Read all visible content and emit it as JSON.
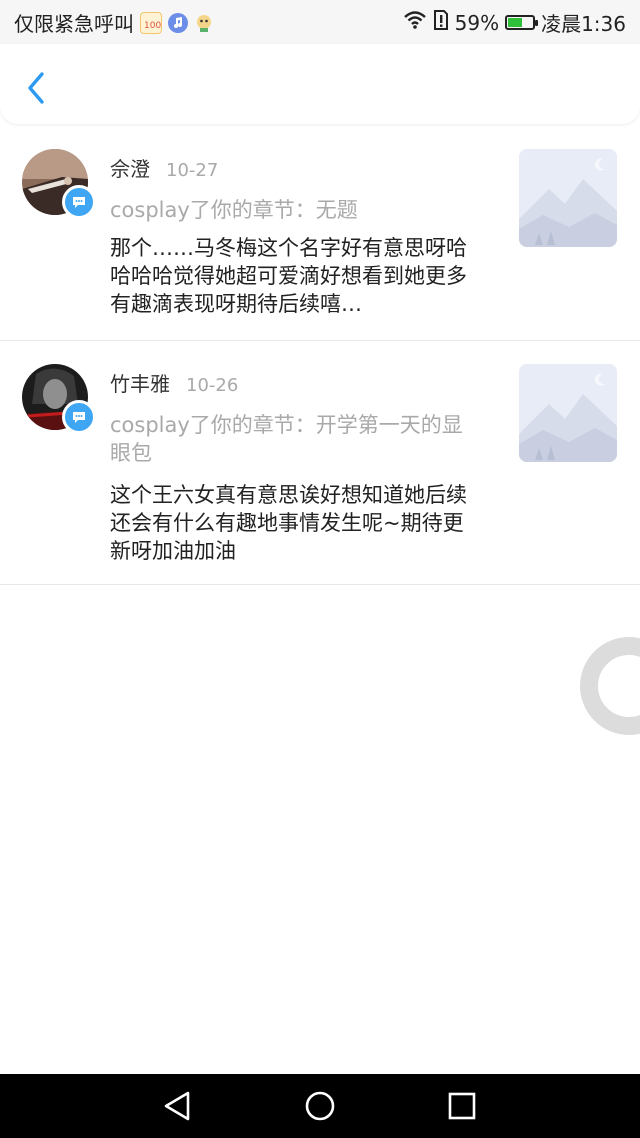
{
  "status_bar": {
    "carrier": "仅限紧急呼叫",
    "battery_percent": "59%",
    "battery_level": 0.59,
    "time": "凌晨1:36",
    "app_icons": [
      "calendar-100-icon",
      "music-icon",
      "avatar-app-icon"
    ]
  },
  "nav": {
    "back_icon": "chevron-left-icon"
  },
  "notifications": [
    {
      "name": "佘澄",
      "date": "10-27",
      "action": "cosplay了你的章节：无题",
      "text": "那个……马冬梅这个名字好有意思呀哈哈哈哈觉得她超可爱滴好想看到她更多有趣滴表现呀期待后续嘻…"
    },
    {
      "name": "竹丰雅",
      "date": "10-26",
      "action": "cosplay了你的章节：开学第一天的显眼包",
      "text": "这个王六女真有意思诶好想知道她后续还会有什么有趣地事情发生呢~期待更新呀加油加油"
    }
  ],
  "colors": {
    "accent": "#3ea6f2",
    "muted": "#a9a9a9"
  }
}
